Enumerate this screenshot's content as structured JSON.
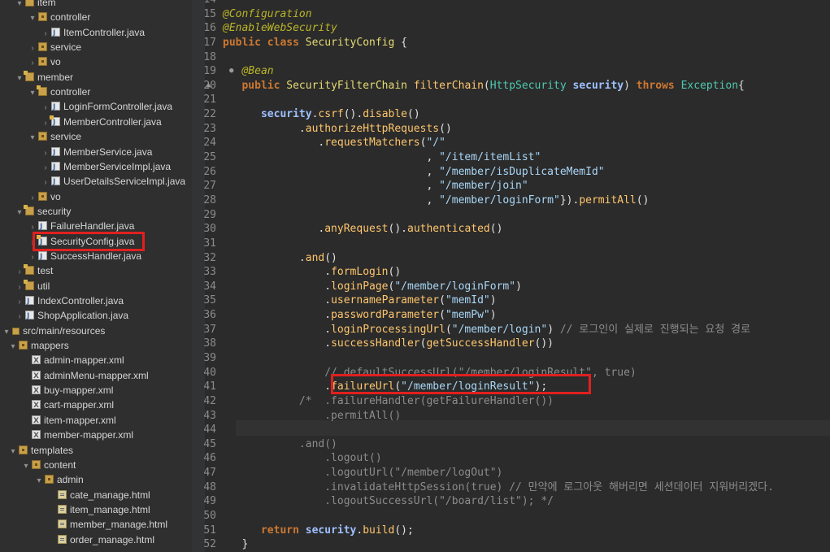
{
  "explorer": {
    "rows": [
      {
        "label": "item",
        "depth": 0,
        "chev": "▾",
        "icon": "pkgm",
        "icon_name": "package-icon"
      },
      {
        "label": "controller",
        "depth": 1,
        "chev": "▾",
        "icon": "pkg",
        "icon_name": "package-icon"
      },
      {
        "label": "ItemController.java",
        "depth": 2,
        "chev": "›",
        "icon": "java",
        "icon_name": "java-file-icon"
      },
      {
        "label": "service",
        "depth": 1,
        "chev": "›",
        "icon": "pkg",
        "icon_name": "package-icon"
      },
      {
        "label": "vo",
        "depth": 1,
        "chev": "›",
        "icon": "pkg",
        "icon_name": "package-icon"
      },
      {
        "label": "member",
        "depth": 0,
        "chev": "▾",
        "icon": "pkgm",
        "icon_name": "package-icon"
      },
      {
        "label": "controller",
        "depth": 1,
        "chev": "▾",
        "icon": "pkgm",
        "icon_name": "package-icon"
      },
      {
        "label": "LoginFormController.java",
        "depth": 2,
        "chev": "›",
        "icon": "java",
        "icon_name": "java-file-icon"
      },
      {
        "label": "MemberController.java",
        "depth": 2,
        "chev": "›",
        "icon": "javam",
        "icon_name": "java-file-icon"
      },
      {
        "label": "service",
        "depth": 1,
        "chev": "▾",
        "icon": "pkg",
        "icon_name": "package-icon"
      },
      {
        "label": "MemberService.java",
        "depth": 2,
        "chev": "›",
        "icon": "java",
        "icon_name": "java-file-icon"
      },
      {
        "label": "MemberServiceImpl.java",
        "depth": 2,
        "chev": "›",
        "icon": "java",
        "icon_name": "java-file-icon"
      },
      {
        "label": "UserDetailsServiceImpl.java",
        "depth": 2,
        "chev": "›",
        "icon": "java",
        "icon_name": "java-file-icon"
      },
      {
        "label": "vo",
        "depth": 1,
        "chev": "›",
        "icon": "pkg",
        "icon_name": "package-icon"
      },
      {
        "label": "security",
        "depth": 0,
        "chev": "▾",
        "icon": "pkgm",
        "icon_name": "package-icon"
      },
      {
        "label": "FailureHandler.java",
        "depth": 1,
        "chev": "›",
        "icon": "java",
        "icon_name": "java-file-icon"
      },
      {
        "label": "SecurityConfig.java",
        "depth": 1,
        "chev": "›",
        "icon": "javam",
        "icon_name": "java-file-icon"
      },
      {
        "label": "SuccessHandler.java",
        "depth": 1,
        "chev": "›",
        "icon": "java",
        "icon_name": "java-file-icon"
      },
      {
        "label": "test",
        "depth": 0,
        "chev": "›",
        "icon": "pkgm",
        "icon_name": "package-icon"
      },
      {
        "label": "util",
        "depth": 0,
        "chev": "›",
        "icon": "pkgm",
        "icon_name": "package-icon"
      },
      {
        "label": "IndexController.java",
        "depth": 0,
        "chev": "›",
        "icon": "java",
        "icon_name": "java-file-icon"
      },
      {
        "label": "ShopApplication.java",
        "depth": 0,
        "chev": "›",
        "icon": "java",
        "icon_name": "java-file-icon"
      },
      {
        "label": "src/main/resources",
        "depth": -1,
        "chev": "▾",
        "icon": "srcf",
        "icon_name": "source-folder-icon"
      },
      {
        "label": "mappers",
        "depth": -0.5,
        "chev": "▾",
        "icon": "pkg",
        "icon_name": "package-icon"
      },
      {
        "label": "admin-mapper.xml",
        "depth": 0.5,
        "chev": "",
        "icon": "xml",
        "icon_name": "xml-file-icon"
      },
      {
        "label": "adminMenu-mapper.xml",
        "depth": 0.5,
        "chev": "",
        "icon": "xml",
        "icon_name": "xml-file-icon"
      },
      {
        "label": "buy-mapper.xml",
        "depth": 0.5,
        "chev": "",
        "icon": "xml",
        "icon_name": "xml-file-icon"
      },
      {
        "label": "cart-mapper.xml",
        "depth": 0.5,
        "chev": "",
        "icon": "xml",
        "icon_name": "xml-file-icon"
      },
      {
        "label": "item-mapper.xml",
        "depth": 0.5,
        "chev": "",
        "icon": "xml",
        "icon_name": "xml-file-icon"
      },
      {
        "label": "member-mapper.xml",
        "depth": 0.5,
        "chev": "",
        "icon": "xml",
        "icon_name": "xml-file-icon"
      },
      {
        "label": "templates",
        "depth": -0.5,
        "chev": "▾",
        "icon": "pkg",
        "icon_name": "package-icon"
      },
      {
        "label": "content",
        "depth": 0.5,
        "chev": "▾",
        "icon": "pkg",
        "icon_name": "package-icon"
      },
      {
        "label": "admin",
        "depth": 1.5,
        "chev": "▾",
        "icon": "pkg",
        "icon_name": "package-icon"
      },
      {
        "label": "cate_manage.html",
        "depth": 2.5,
        "chev": "",
        "icon": "html",
        "icon_name": "html-file-icon"
      },
      {
        "label": "item_manage.html",
        "depth": 2.5,
        "chev": "",
        "icon": "html",
        "icon_name": "html-file-icon"
      },
      {
        "label": "member_manage.html",
        "depth": 2.5,
        "chev": "",
        "icon": "html",
        "icon_name": "html-file-icon"
      },
      {
        "label": "order_manage.html",
        "depth": 2.5,
        "chev": "",
        "icon": "html",
        "icon_name": "html-file-icon"
      }
    ]
  },
  "editor": {
    "lines": [
      {
        "n": "14",
        "tokens": []
      },
      {
        "n": "15",
        "tokens": [
          [
            "ann",
            "@Configuration"
          ]
        ]
      },
      {
        "n": "16",
        "tokens": [
          [
            "ann",
            "@EnableWebSecurity"
          ]
        ]
      },
      {
        "n": "17",
        "tokens": [
          [
            "kw",
            "public "
          ],
          [
            "kw",
            "class "
          ],
          [
            "cls",
            "SecurityConfig"
          ],
          [
            "pl",
            " {"
          ]
        ]
      },
      {
        "n": "18",
        "tokens": []
      },
      {
        "n": "19",
        "tokens": [
          [
            "pl",
            "   "
          ],
          [
            "ann",
            "@Bean"
          ]
        ]
      },
      {
        "n": "20",
        "tokens": [
          [
            "pl",
            "   "
          ],
          [
            "kw",
            "public "
          ],
          [
            "cls",
            "SecurityFilterChain "
          ],
          [
            "fn",
            "filterChain"
          ],
          [
            "pl",
            "("
          ],
          [
            "typ",
            "HttpSecurity "
          ],
          [
            "var",
            "security"
          ],
          [
            "pl",
            ") "
          ],
          [
            "kw",
            "throws "
          ],
          [
            "typ",
            "Exception"
          ],
          [
            "pl",
            "{"
          ]
        ]
      },
      {
        "n": "21",
        "tokens": []
      },
      {
        "n": "22",
        "tokens": [
          [
            "pl",
            "      "
          ],
          [
            "var",
            "security"
          ],
          [
            "pl",
            "."
          ],
          [
            "fn",
            "csrf"
          ],
          [
            "pl",
            "()."
          ],
          [
            "fn",
            "disable"
          ],
          [
            "pl",
            "()"
          ]
        ]
      },
      {
        "n": "23",
        "tokens": [
          [
            "pl",
            "            ."
          ],
          [
            "fn",
            "authorizeHttpRequests"
          ],
          [
            "pl",
            "()"
          ]
        ]
      },
      {
        "n": "24",
        "tokens": [
          [
            "pl",
            "               ."
          ],
          [
            "fn",
            "requestMatchers"
          ],
          [
            "pl",
            "("
          ],
          [
            "strb",
            "\"/\""
          ]
        ]
      },
      {
        "n": "25",
        "tokens": [
          [
            "pl",
            "                                , "
          ],
          [
            "strb",
            "\"/item/itemList\""
          ]
        ]
      },
      {
        "n": "26",
        "tokens": [
          [
            "pl",
            "                                , "
          ],
          [
            "strb",
            "\"/member/isDuplicateMemId\""
          ]
        ]
      },
      {
        "n": "27",
        "tokens": [
          [
            "pl",
            "                                , "
          ],
          [
            "strb",
            "\"/member/join\""
          ]
        ]
      },
      {
        "n": "28",
        "tokens": [
          [
            "pl",
            "                                , "
          ],
          [
            "strb",
            "\"/member/loginForm\""
          ],
          [
            "pl",
            "})."
          ],
          [
            "fn",
            "permitAll"
          ],
          [
            "pl",
            "()"
          ]
        ]
      },
      {
        "n": "29",
        "tokens": []
      },
      {
        "n": "30",
        "tokens": [
          [
            "pl",
            "               ."
          ],
          [
            "fn",
            "anyRequest"
          ],
          [
            "pl",
            "()."
          ],
          [
            "fn",
            "authenticated"
          ],
          [
            "pl",
            "()"
          ]
        ]
      },
      {
        "n": "31",
        "tokens": []
      },
      {
        "n": "32",
        "tokens": [
          [
            "pl",
            "            ."
          ],
          [
            "fn",
            "and"
          ],
          [
            "pl",
            "()"
          ]
        ]
      },
      {
        "n": "33",
        "tokens": [
          [
            "pl",
            "                ."
          ],
          [
            "fn",
            "formLogin"
          ],
          [
            "pl",
            "()"
          ]
        ]
      },
      {
        "n": "34",
        "tokens": [
          [
            "pl",
            "                ."
          ],
          [
            "fn",
            "loginPage"
          ],
          [
            "pl",
            "("
          ],
          [
            "strb",
            "\"/member/loginForm\""
          ],
          [
            "pl",
            ")"
          ]
        ]
      },
      {
        "n": "35",
        "tokens": [
          [
            "pl",
            "                ."
          ],
          [
            "fn",
            "usernameParameter"
          ],
          [
            "pl",
            "("
          ],
          [
            "strb",
            "\"memId\""
          ],
          [
            "pl",
            ")"
          ]
        ]
      },
      {
        "n": "36",
        "tokens": [
          [
            "pl",
            "                ."
          ],
          [
            "fn",
            "passwordParameter"
          ],
          [
            "pl",
            "("
          ],
          [
            "strb",
            "\"memPw\""
          ],
          [
            "pl",
            ")"
          ]
        ]
      },
      {
        "n": "37",
        "tokens": [
          [
            "pl",
            "                ."
          ],
          [
            "fn",
            "loginProcessingUrl"
          ],
          [
            "pl",
            "("
          ],
          [
            "strb",
            "\"/member/login\""
          ],
          [
            "pl",
            ") "
          ],
          [
            "cmt",
            "// 로그인이 실제로 진행되는 요청 경로"
          ]
        ]
      },
      {
        "n": "38",
        "tokens": [
          [
            "pl",
            "                ."
          ],
          [
            "fn",
            "successHandler"
          ],
          [
            "pl",
            "("
          ],
          [
            "fn",
            "getSuccessHandler"
          ],
          [
            "pl",
            "())"
          ]
        ]
      },
      {
        "n": "39",
        "tokens": []
      },
      {
        "n": "40",
        "tokens": [
          [
            "cmt",
            "                // defaultSuccessUrl(\"/member/loginResult\", true)"
          ]
        ]
      },
      {
        "n": "41",
        "tokens": [
          [
            "pl",
            "                ."
          ],
          [
            "fn",
            "failureUrl"
          ],
          [
            "pl",
            "("
          ],
          [
            "strb",
            "\"/member/loginResult\""
          ],
          [
            "pl",
            ");"
          ]
        ]
      },
      {
        "n": "42",
        "tokens": [
          [
            "cmt",
            "            /*  .failureHandler(getFailureHandler())"
          ]
        ]
      },
      {
        "n": "43",
        "tokens": [
          [
            "cmt",
            "                .permitAll()"
          ]
        ]
      },
      {
        "n": "44",
        "tokens": []
      },
      {
        "n": "45",
        "tokens": [
          [
            "cmt",
            "            .and()"
          ]
        ]
      },
      {
        "n": "46",
        "tokens": [
          [
            "cmt",
            "                .logout()"
          ]
        ]
      },
      {
        "n": "47",
        "tokens": [
          [
            "cmt",
            "                .logoutUrl(\"/member/logOut\")"
          ]
        ]
      },
      {
        "n": "48",
        "tokens": [
          [
            "cmt",
            "                .invalidateHttpSession(true) // 만약에 로그아웃 해버리면 세션데이터 지워버리겠다."
          ]
        ]
      },
      {
        "n": "49",
        "tokens": [
          [
            "cmt",
            "                .logoutSuccessUrl(\"/board/list\"); */"
          ]
        ]
      },
      {
        "n": "50",
        "tokens": []
      },
      {
        "n": "51",
        "tokens": [
          [
            "pl",
            "      "
          ],
          [
            "kw",
            "return "
          ],
          [
            "var",
            "security"
          ],
          [
            "pl",
            "."
          ],
          [
            "fn",
            "build"
          ],
          [
            "pl",
            "();"
          ]
        ]
      },
      {
        "n": "52",
        "tokens": [
          [
            "pl",
            "   }"
          ]
        ]
      }
    ],
    "gutter_marks": {
      "19": "●",
      "20": "▲"
    }
  }
}
